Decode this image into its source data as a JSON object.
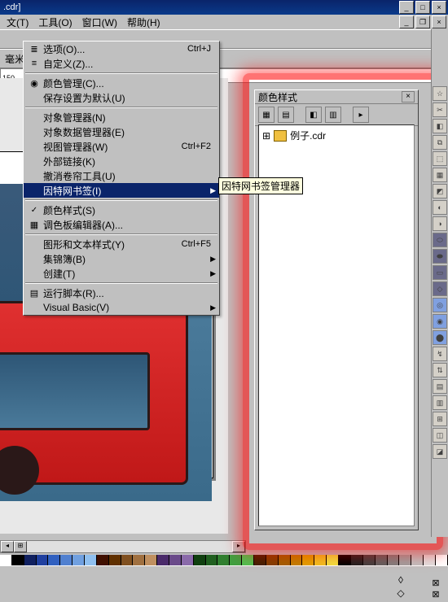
{
  "title": ".cdr]",
  "menubar": [
    "文(T)",
    "工具(O)",
    "窗口(W)",
    "帮助(H)"
  ],
  "menubar_gap_right_controls": true,
  "unit_label": "毫米",
  "ruler_marks": [
    "150"
  ],
  "dropdown": {
    "items": [
      {
        "icon": "opts-icon",
        "label": "选项(O)...",
        "shortcut": "Ctrl+J"
      },
      {
        "icon": "customize-icon",
        "label": "自定义(Z)..."
      },
      {
        "icon": "sep"
      },
      {
        "icon": "color-mgmt-icon",
        "label": "颜色管理(C)..."
      },
      {
        "icon": "",
        "label": "保存设置为默认(U)"
      },
      {
        "icon": "sep"
      },
      {
        "icon": "",
        "label": "对象管理器(N)"
      },
      {
        "icon": "",
        "label": "对象数据管理器(E)"
      },
      {
        "icon": "",
        "label": "视图管理器(W)",
        "shortcut": "Ctrl+F2"
      },
      {
        "icon": "",
        "label": "外部链接(K)"
      },
      {
        "icon": "",
        "label": "撤消卷帘工具(U)"
      },
      {
        "icon": "",
        "label": "因特网书签(I)",
        "highlight": true,
        "arrow": true
      },
      {
        "icon": "sep"
      },
      {
        "icon": "check",
        "label": "颜色样式(S)"
      },
      {
        "icon": "palette-icon",
        "label": "调色板编辑器(A)..."
      },
      {
        "icon": "sep"
      },
      {
        "icon": "",
        "label": "图形和文本样式(Y)",
        "shortcut": "Ctrl+F5"
      },
      {
        "icon": "",
        "label": "集锦簿(B)",
        "arrow": true
      },
      {
        "icon": "",
        "label": "创建(T)",
        "arrow": true
      },
      {
        "icon": "sep"
      },
      {
        "icon": "script-icon",
        "label": "运行脚本(R)..."
      },
      {
        "icon": "",
        "label": "Visual Basic(V)",
        "arrow": true
      }
    ]
  },
  "tooltip": "因特网书签管理器",
  "docker": {
    "title": "颜色样式",
    "tree_item": "例子.cdr"
  },
  "palette_colors": [
    "#fff",
    "#000",
    "#102060",
    "#2040a0",
    "#3060c0",
    "#5080d0",
    "#70a0e0",
    "#90c0f0",
    "#401000",
    "#603000",
    "#805020",
    "#a07040",
    "#c09060",
    "#4a2a6a",
    "#6a4a8a",
    "#8a6aaa",
    "#104010",
    "#206020",
    "#308030",
    "#40a040",
    "#50c050",
    "#402000",
    "#804000",
    "#a06000",
    "#c08000",
    "#e0a000",
    "#f0c020",
    "#f0e040",
    "#000",
    "#202020",
    "#404040",
    "#606060",
    "#808080",
    "#a0a0a0",
    "#c0c0c0",
    "#e0e0e0",
    "#ffffff"
  ],
  "right_tools": [
    "☆",
    "✂",
    "◧",
    "⧉",
    "⬚",
    "▦",
    "◩",
    "◐",
    "◑",
    "⬭",
    "⬬",
    "▭",
    "◇",
    "◎",
    "◉",
    "⬤",
    "↯",
    "⇅",
    "▤",
    "▥",
    "⊞",
    "◫",
    "◪"
  ]
}
